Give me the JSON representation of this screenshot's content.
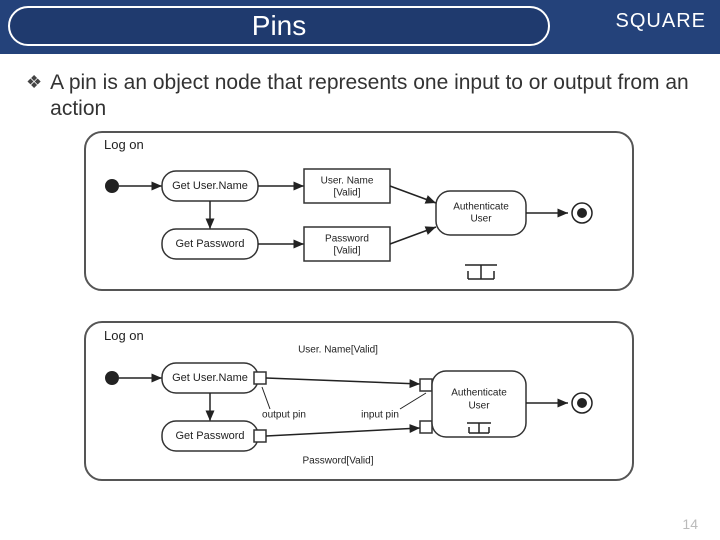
{
  "header": {
    "title": "Pins",
    "brand": "SQUARE"
  },
  "bullet": "A pin is an object node that represents one input to or output from an action",
  "diagram1": {
    "label": "Log on",
    "action1": "Get User.Name",
    "action2": "Get Password",
    "obj1a": "User. Name",
    "obj1b": "[Valid]",
    "obj2a": "Password",
    "obj2b": "[Valid]",
    "action3a": "Authenticate",
    "action3b": "User"
  },
  "diagram2": {
    "label": "Log on",
    "action1": "Get User.Name",
    "action2": "Get Password",
    "pin1": "User. Name[Valid]",
    "pin2": "Password[Valid]",
    "outpin": "output pin",
    "inpin": "input pin",
    "action3a": "Authenticate",
    "action3b": "User"
  },
  "page": "14"
}
